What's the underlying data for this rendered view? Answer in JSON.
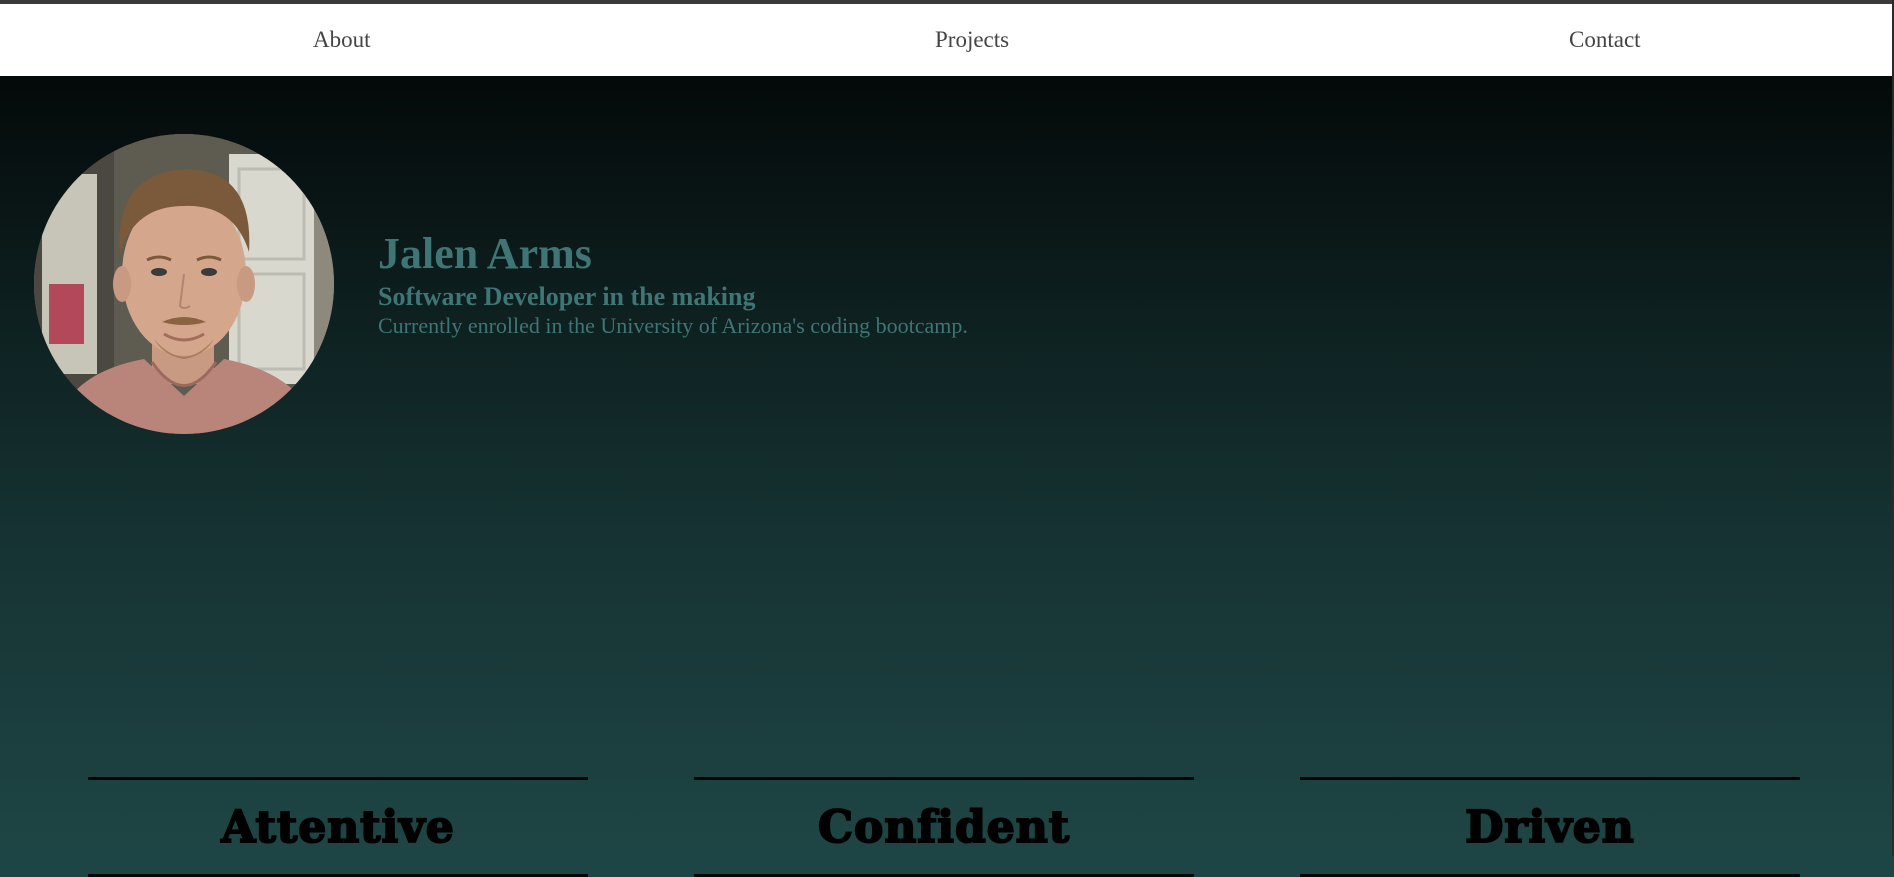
{
  "nav": {
    "about_label": "About",
    "projects_label": "Projects",
    "contact_label": "Contact"
  },
  "hero": {
    "name": "Jalen Arms",
    "tagline": "Software Developer in the making",
    "blurb": "Currently enrolled in the University of Arizona's coding bootcamp."
  },
  "traits": [
    {
      "label": "Attentive"
    },
    {
      "label": "Confident"
    },
    {
      "label": "Driven"
    }
  ],
  "colors": {
    "nav_background": "#ffffff",
    "nav_text": "#444444",
    "hero_gradient_top": "#040909",
    "hero_gradient_bottom": "#1e4545",
    "hero_text": "#3f7575",
    "trait_text": "#000000"
  },
  "icons": {
    "avatar": "profile-photo"
  }
}
